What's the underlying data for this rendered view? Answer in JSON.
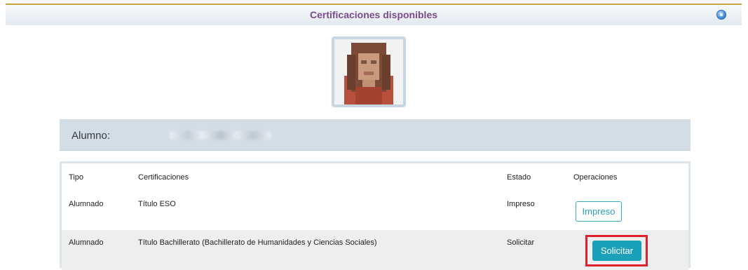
{
  "header": {
    "title": "Certificaciones disponibles",
    "icon": "circle-arrow-icon"
  },
  "student": {
    "label": "Alumno:"
  },
  "table": {
    "columns": [
      "Tipo",
      "Certificaciones",
      "Estado",
      "Operaciones"
    ],
    "rows": [
      {
        "tipo": "Alumnado",
        "certificacion": "Título ESO",
        "estado": "Impreso",
        "operacion": "Impreso"
      },
      {
        "tipo": "Alumnado",
        "certificacion": "Título Bachillerato (Bachillerato de Humanidades y Ciencias Sociales)",
        "estado": "Solicitar",
        "operacion": "Solicitar"
      }
    ]
  },
  "colors": {
    "title": "#7a4b8a",
    "accent": "#1aa0b8",
    "highlight": "#e0202a",
    "panel": "#d3dde6"
  }
}
